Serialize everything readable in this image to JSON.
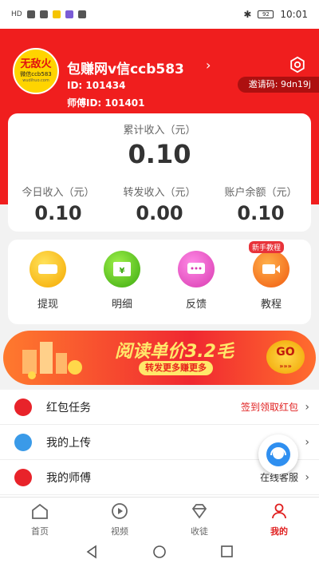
{
  "status_bar": {
    "left_text": "HD",
    "time": "10:01",
    "battery": "92"
  },
  "header": {
    "logo_line1": "无敌火",
    "logo_line2": "微信ccb583",
    "logo_line3": "wudihuo.com",
    "user_name": "包赚网v信ccb583",
    "user_id": "ID: 101434",
    "master_id": "师傅ID:  101401",
    "invite_code": "邀请码: 9dn19j"
  },
  "income": {
    "total_label": "累计收入（元）",
    "total_value": "0.10",
    "stats": [
      {
        "label": "今日收入（元）",
        "value": "0.10"
      },
      {
        "label": "转发收入（元）",
        "value": "0.00"
      },
      {
        "label": "账户余额（元）",
        "value": "0.10"
      }
    ]
  },
  "actions": [
    {
      "label": "提现",
      "icon": "withdraw-icon",
      "color": "#ffc400"
    },
    {
      "label": "明细",
      "icon": "detail-icon",
      "color": "#5cc81e"
    },
    {
      "label": "反馈",
      "icon": "feedback-icon",
      "color": "#f25cc4"
    },
    {
      "label": "教程",
      "icon": "tutorial-icon",
      "color": "#ff6a1e",
      "badge": "新手教程"
    }
  ],
  "banner": {
    "title": "阅读单价3.2毛",
    "subtitle": "转发更多赚更多",
    "go": "GO"
  },
  "list": [
    {
      "label": "红包任务",
      "extra": "签到领取红包",
      "icon_color": "#e8232a"
    },
    {
      "label": "我的上传",
      "extra": "",
      "icon_color": "#3a9ae8"
    },
    {
      "label": "我的师傅",
      "extra": "在线客服",
      "icon_color": "#e8232a"
    }
  ],
  "tabs": [
    {
      "label": "首页",
      "active": false
    },
    {
      "label": "视频",
      "active": false
    },
    {
      "label": "收徒",
      "active": false
    },
    {
      "label": "我的",
      "active": true
    }
  ],
  "colors": {
    "brand_red": "#f01e1e",
    "active_tab": "#e02020"
  }
}
